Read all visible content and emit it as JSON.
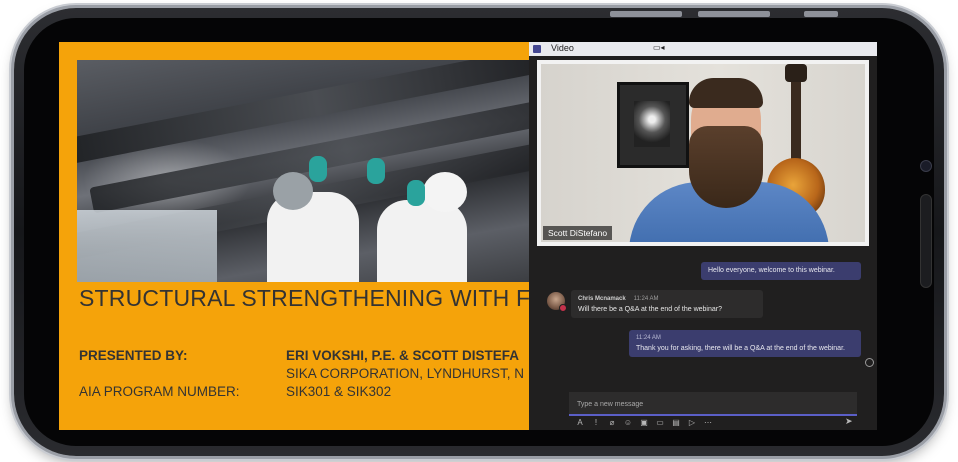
{
  "slide": {
    "title": "STRUCTURAL STRENGTHENING WITH FRP",
    "presented_by_label": "PRESENTED BY:",
    "presenters": "ERI VOKSHI, P.E.  & SCOTT DISTEFA",
    "company": "SIKA CORPORATION, LYNDHURST, N",
    "aia_label": "AIA PROGRAM NUMBER:",
    "aia_value": "SIK301 & SIK302"
  },
  "video_window": {
    "title": "Video",
    "camera_icon": "camera-icon",
    "participant_name": "Scott DiStefano"
  },
  "chat": {
    "messages": [
      {
        "text": "Hello everyone, welcome to this webinar."
      },
      {
        "author": "Chris Mcnamack",
        "time": "11:24 AM",
        "text": "Will there be a Q&A at the end of the webinar?"
      },
      {
        "time": "11:24 AM",
        "text": "Thank you for asking, there will be a Q&A at the end of the webinar."
      }
    ],
    "compose_placeholder": "Type a new message",
    "toolbar_icons": [
      "format-icon",
      "priority-icon",
      "attach-icon",
      "emoji-icon",
      "gif-icon",
      "sticker-icon",
      "schedule-icon",
      "stream-icon",
      "more-icon"
    ],
    "toolbar_glyphs": [
      "A",
      "!",
      "⌀",
      "☺",
      "▣",
      "▭",
      "▤",
      "▷",
      "⋯"
    ],
    "send_glyph": "➤"
  },
  "colors": {
    "slide_orange": "#f5a30a",
    "teams_dark": "#201f1f",
    "message_mine": "#3b3d6e",
    "accent_purple": "#5b5fc7"
  }
}
